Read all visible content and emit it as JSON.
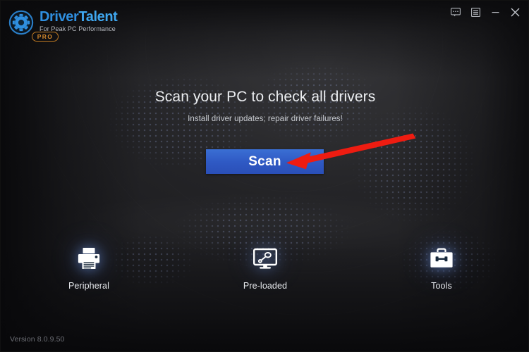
{
  "app": {
    "brand_word1": "Driver",
    "brand_word2": "Talent",
    "brand_tagline": "For Peak PC Performance",
    "brand_badge": "PRO",
    "accent_blue": "#2f8fe0",
    "accent_orange": "#d68a2c",
    "button_blue": "#2f59c4",
    "arrow_red": "#ee1c11",
    "version": "Version 8.0.9.50"
  },
  "titlebar": {
    "logo_icon": "gear-in-circle-icon",
    "controls": [
      {
        "name": "feedback-button",
        "icon": "chat-bubble-icon",
        "tooltip": "Feedback"
      },
      {
        "name": "menu-button",
        "icon": "list-menu-icon",
        "tooltip": "Menu"
      },
      {
        "name": "minimize-button",
        "icon": "minimize-icon",
        "tooltip": "Minimize"
      },
      {
        "name": "close-button",
        "icon": "close-x-icon",
        "tooltip": "Close"
      }
    ]
  },
  "hero": {
    "title": "Scan your PC to check all drivers",
    "subtitle": "Install driver updates; repair driver failures!",
    "scan_label": "Scan"
  },
  "features": [
    {
      "label": "Peripheral",
      "icon": "printer-icon"
    },
    {
      "label": "Pre-loaded",
      "icon": "monitor-peripheral-icon"
    },
    {
      "label": "Tools",
      "icon": "toolbox-icon"
    }
  ]
}
